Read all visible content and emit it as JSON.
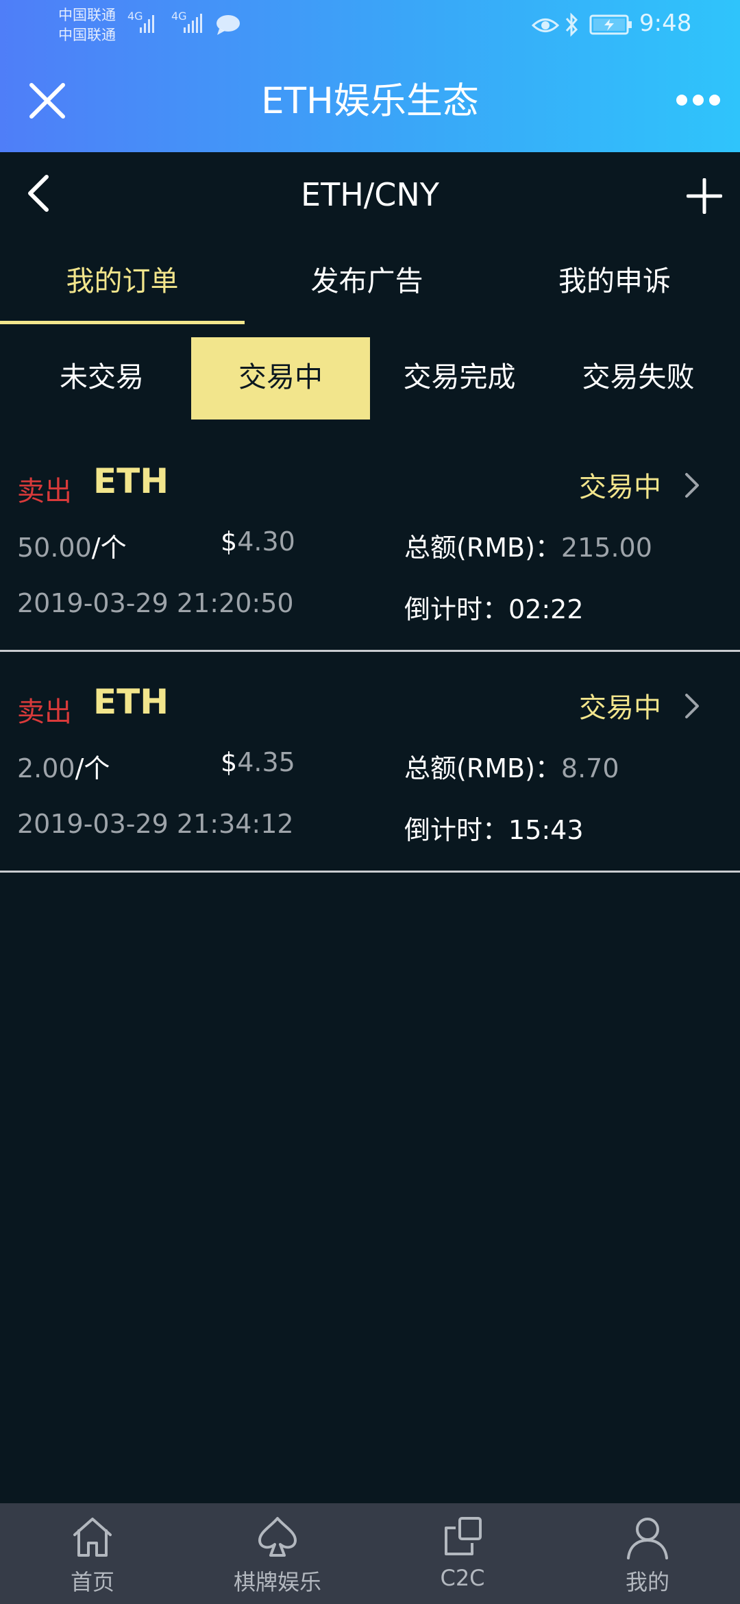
{
  "status_bar": {
    "carrier_1": "中国联通",
    "carrier_2": "中国联通",
    "network_1": "4G",
    "network_2": "4G",
    "time": "9:48"
  },
  "header": {
    "title": "ETH娱乐生态"
  },
  "nav": {
    "pair": "ETH/CNY"
  },
  "main_tabs": [
    {
      "label": "我的订单",
      "active": true
    },
    {
      "label": "发布广告",
      "active": false
    },
    {
      "label": "我的申诉",
      "active": false
    }
  ],
  "sub_tabs": [
    {
      "label": "未交易",
      "active": false
    },
    {
      "label": "交易中",
      "active": true
    },
    {
      "label": "交易完成",
      "active": false
    },
    {
      "label": "交易失败",
      "active": false
    }
  ],
  "orders": [
    {
      "side": "卖出",
      "coin": "ETH",
      "status": "交易中",
      "amount": "50.00",
      "unit": "/个",
      "currency_symbol": "$",
      "price": "4.30",
      "total_label": "总额(RMB)：",
      "total": "215.00",
      "datetime": "2019-03-29 21:20:50",
      "countdown_label": "倒计时：",
      "countdown": "02:22"
    },
    {
      "side": "卖出",
      "coin": "ETH",
      "status": "交易中",
      "amount": "2.00",
      "unit": "/个",
      "currency_symbol": "$",
      "price": "4.35",
      "total_label": "总额(RMB)：",
      "total": "8.70",
      "datetime": "2019-03-29 21:34:12",
      "countdown_label": "倒计时：",
      "countdown": "15:43"
    }
  ],
  "bottom_nav": [
    {
      "label": "首页",
      "icon": "home-icon"
    },
    {
      "label": "棋牌娱乐",
      "icon": "spade-icon"
    },
    {
      "label": "C2C",
      "icon": "c2c-icon"
    },
    {
      "label": "我的",
      "icon": "person-icon"
    }
  ],
  "colors": {
    "accent": "#f2e58c",
    "sell": "#d93a3a",
    "background": "#09171f",
    "header_gradient_start": "#4f7ef8",
    "header_gradient_end": "#2fc4fb",
    "bottom_nav_bg": "#363c48"
  }
}
